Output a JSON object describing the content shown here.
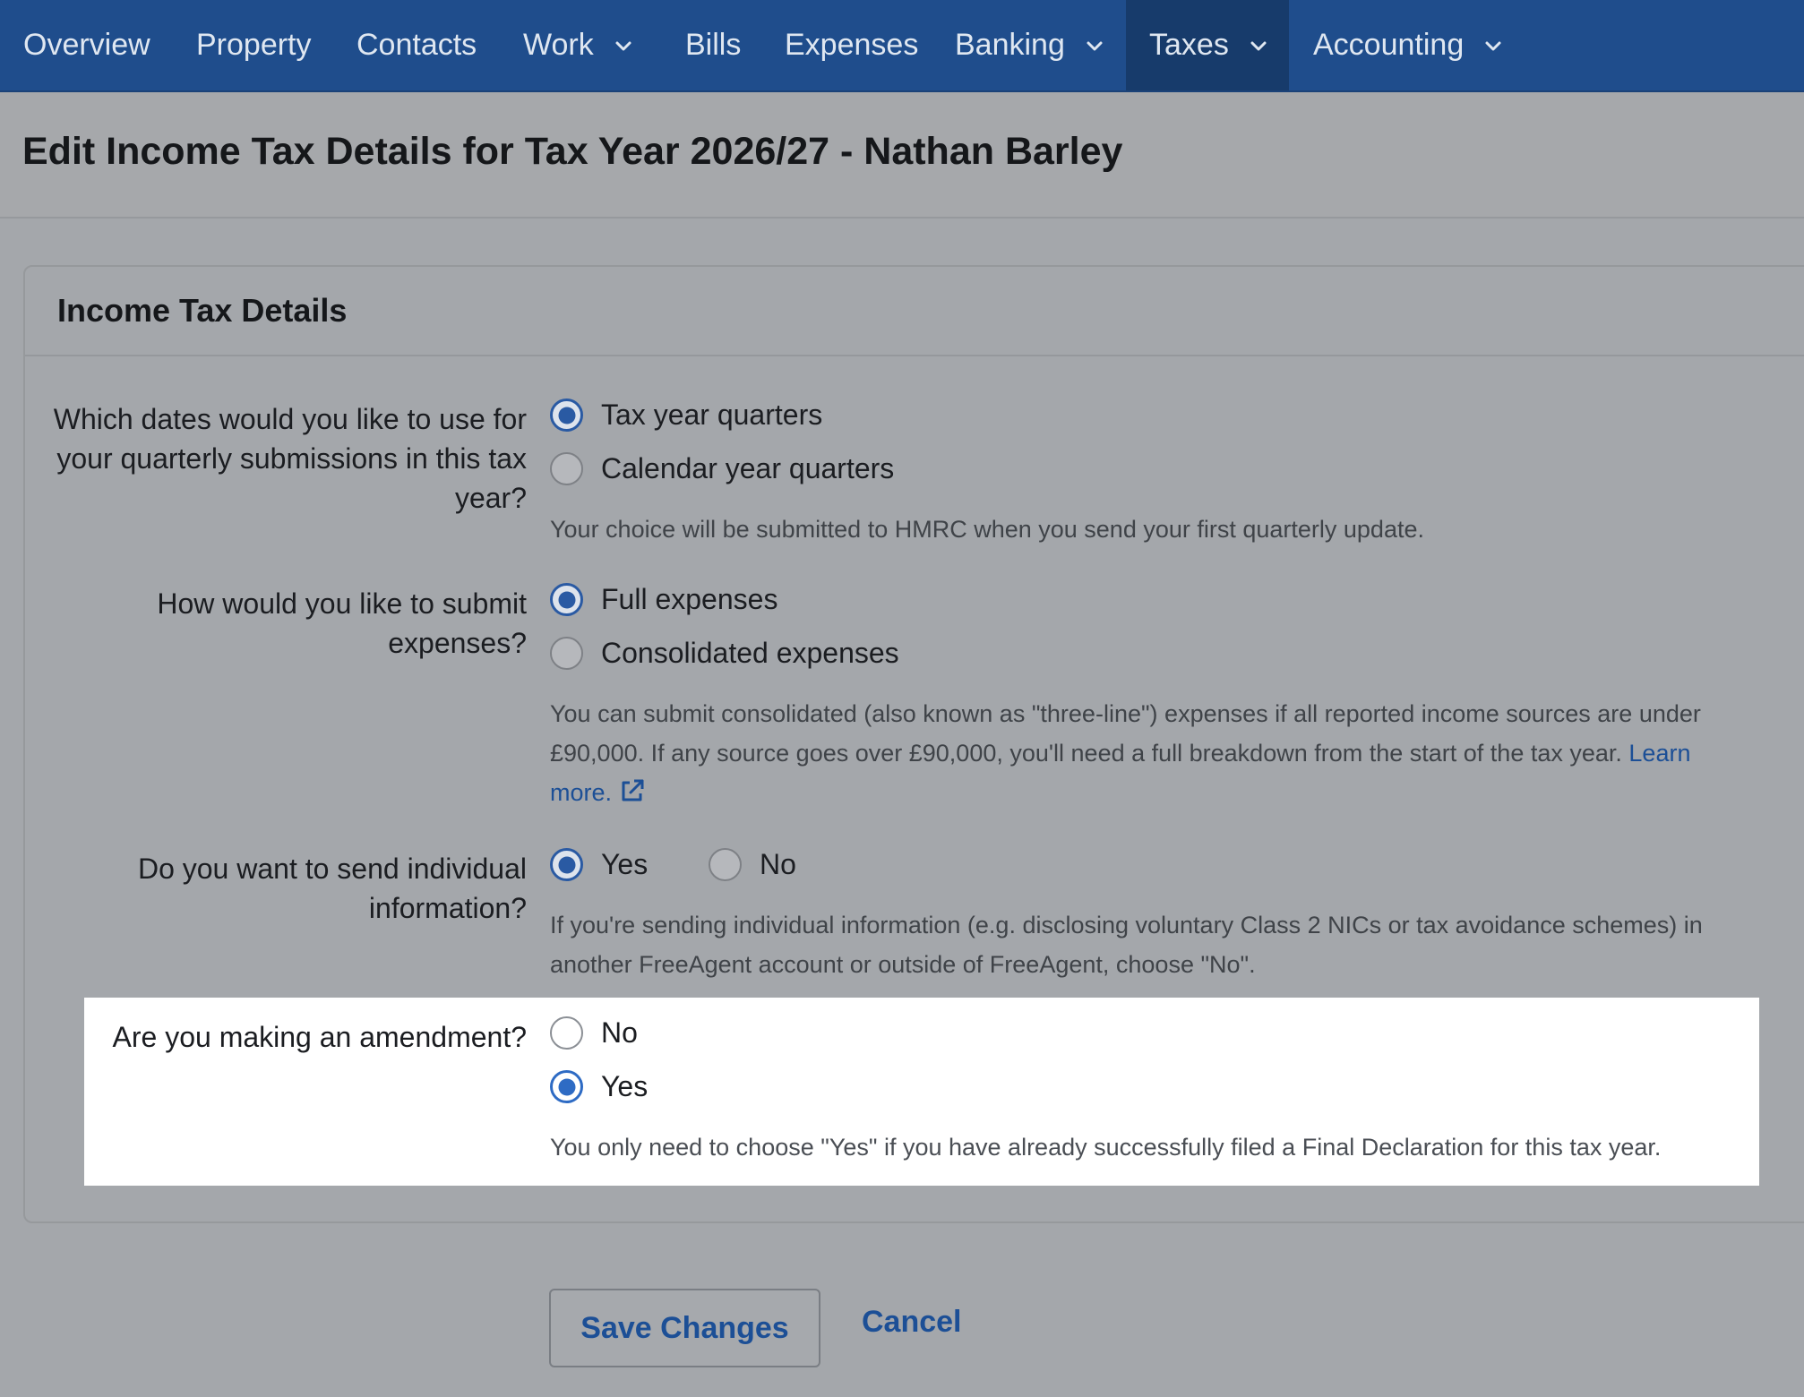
{
  "nav": {
    "items": [
      {
        "label": "Overview"
      },
      {
        "label": "Property"
      },
      {
        "label": "Contacts"
      },
      {
        "label": "Work"
      },
      {
        "label": "Bills"
      },
      {
        "label": "Expenses"
      },
      {
        "label": "Banking"
      },
      {
        "label": "Taxes"
      },
      {
        "label": "Accounting"
      }
    ],
    "active": "Taxes"
  },
  "page": {
    "title": "Edit Income Tax Details for Tax Year 2026/27 - Nathan Barley"
  },
  "card": {
    "title": "Income Tax Details",
    "q1": {
      "label": "Which dates would you like to use for your quarterly submissions in this tax year?",
      "options": [
        "Tax year quarters",
        "Calendar year quarters"
      ],
      "selected": "Tax year quarters",
      "hint": "Your choice will be submitted to HMRC when you send your first quarterly update."
    },
    "q2": {
      "label": "How would you like to submit expenses?",
      "options": [
        "Full expenses",
        "Consolidated expenses"
      ],
      "selected": "Full expenses",
      "hint": "You can submit consolidated (also known as \"three-line\") expenses if all reported income sources are under £90,000. If any source goes over £90,000, you'll need a full breakdown from the start of the tax year.",
      "link": "Learn more."
    },
    "q3": {
      "label": "Do you want to send individual information?",
      "options": [
        "Yes",
        "No"
      ],
      "selected": "Yes",
      "hint": "If you're sending individual information (e.g. disclosing voluntary Class 2 NICs or tax avoidance schemes) in another FreeAgent account or outside of FreeAgent, choose \"No\"."
    },
    "q4": {
      "label": "Are you making an amendment?",
      "options": [
        "No",
        "Yes"
      ],
      "selected": "Yes",
      "hint": "You only need to choose \"Yes\" if you have already successfully filed a Final Declaration for this tax year."
    }
  },
  "actions": {
    "save": "Save Changes",
    "cancel": "Cancel"
  }
}
